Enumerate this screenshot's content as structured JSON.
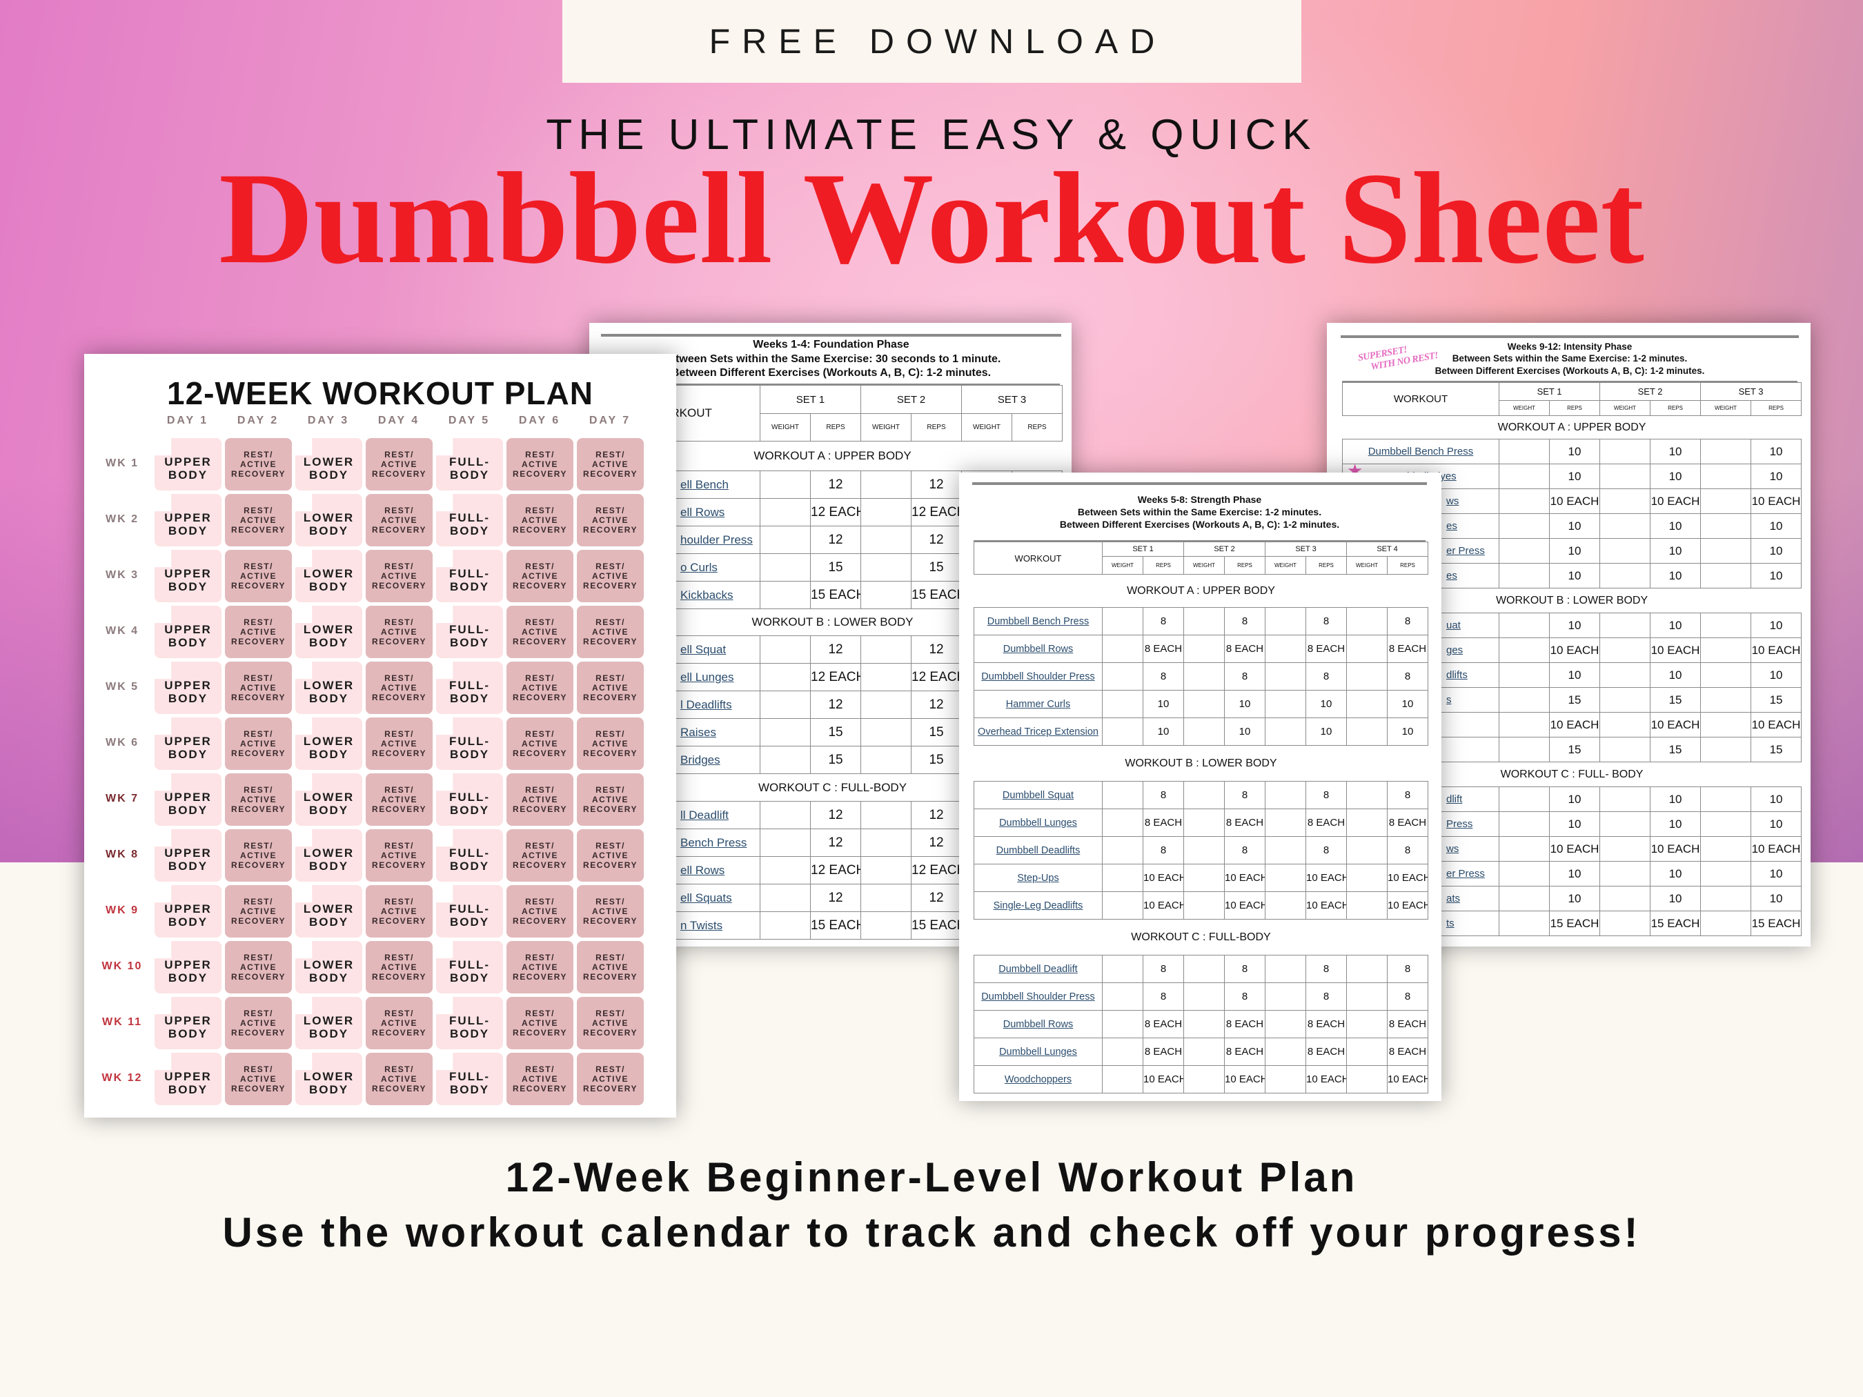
{
  "banner": {
    "free_download": "FREE DOWNLOAD",
    "subtitle": "THE ULTIMATE EASY & QUICK",
    "title": "Dumbbell Workout Sheet",
    "title_color": "#f01c24"
  },
  "plan": {
    "title": "12-WEEK WORKOUT PLAN",
    "days": [
      "DAY 1",
      "DAY 2",
      "DAY 3",
      "DAY 4",
      "DAY 5",
      "DAY 6",
      "DAY 7"
    ],
    "week_pattern": [
      {
        "type": "workout",
        "text": "UPPER\nBODY"
      },
      {
        "type": "rest",
        "text": "REST/\nACTIVE\nRECOVERY"
      },
      {
        "type": "workout",
        "text": "LOWER\nBODY"
      },
      {
        "type": "rest",
        "text": "REST/\nACTIVE\nRECOVERY"
      },
      {
        "type": "workout",
        "text": "FULL-\nBODY"
      },
      {
        "type": "rest",
        "text": "REST/\nACTIVE\nRECOVERY"
      },
      {
        "type": "rest",
        "text": "REST/\nACTIVE\nRECOVERY"
      }
    ],
    "weeks": [
      {
        "label": "WK 1",
        "color": "#8c7a7c"
      },
      {
        "label": "WK 2",
        "color": "#8c7a7c"
      },
      {
        "label": "WK 3",
        "color": "#8c7a7c"
      },
      {
        "label": "WK 4",
        "color": "#8c7a7c"
      },
      {
        "label": "WK 5",
        "color": "#8c7a7c"
      },
      {
        "label": "WK 6",
        "color": "#8c7a7c"
      },
      {
        "label": "WK 7",
        "color": "#7a2a2e"
      },
      {
        "label": "WK 8",
        "color": "#7a2a2e"
      },
      {
        "label": "WK 9",
        "color": "#c0343e"
      },
      {
        "label": "WK 10",
        "color": "#c0343e"
      },
      {
        "label": "WK 11",
        "color": "#c0343e"
      },
      {
        "label": "WK 12",
        "color": "#c0343e"
      }
    ],
    "colors": {
      "workout_cell": "#fde3e5",
      "rest_cell": "#e2b8bb"
    }
  },
  "sheets": [
    {
      "phase": "Weeks 1-4: Foundation Phase",
      "rest_sets": "Between Sets within the Same Exercise: 30 seconds to 1 minute.",
      "rest_exercises": "Between Different Exercises (Workouts A, B, C): 1-2 minutes.",
      "workout_header": "WORKOUT",
      "sets": [
        "SET 1",
        "SET 2",
        "SET 3"
      ],
      "weight_label": "WEIGHT",
      "reps_label": "REPS",
      "sections": [
        {
          "label": "WORKOUT A : UPPER BODY",
          "rows": [
            {
              "exercise": "ell Bench",
              "reps": "12"
            },
            {
              "exercise": "ell Rows",
              "reps": "12 EACH"
            },
            {
              "exercise": "houlder Press",
              "reps": "12"
            },
            {
              "exercise": "o Curls",
              "reps": "15"
            },
            {
              "exercise": "Kickbacks",
              "reps": "15 EACH"
            }
          ]
        },
        {
          "label": "WORKOUT B : LOWER BODY",
          "rows": [
            {
              "exercise": "ell Squat",
              "reps": "12"
            },
            {
              "exercise": "ell Lunges",
              "reps": "12 EACH"
            },
            {
              "exercise": "l Deadlifts",
              "reps": "12"
            },
            {
              "exercise": "Raises",
              "reps": "15"
            },
            {
              "exercise": "Bridges",
              "reps": "15"
            }
          ]
        },
        {
          "label": "WORKOUT C : FULL-BODY",
          "rows": [
            {
              "exercise": "ll Deadlift",
              "reps": "12"
            },
            {
              "exercise": "Bench Press",
              "reps": "12"
            },
            {
              "exercise": "ell Rows",
              "reps": "12 EACH"
            },
            {
              "exercise": "ell Squats",
              "reps": "12"
            },
            {
              "exercise": "n Twists",
              "reps": "15 EACH"
            }
          ]
        }
      ]
    },
    {
      "phase": "Weeks 5-8: Strength Phase",
      "rest_sets": "Between Sets within the Same Exercise:  1-2 minutes.",
      "rest_exercises": "Between Different Exercises (Workouts A, B, C): 1-2 minutes.",
      "workout_header": "WORKOUT",
      "sets": [
        "SET 1",
        "SET 2",
        "SET 3",
        "SET 4"
      ],
      "weight_label": "WEIGHT",
      "reps_label": "REPS",
      "sections": [
        {
          "label": "WORKOUT A : UPPER BODY",
          "rows": [
            {
              "exercise": "Dumbbell Bench Press",
              "reps": "8"
            },
            {
              "exercise": "Dumbbell Rows",
              "reps": "8 EACH"
            },
            {
              "exercise": "Dumbbell Shoulder Press",
              "reps": "8"
            },
            {
              "exercise": "Hammer Curls",
              "reps": "10"
            },
            {
              "exercise": "Overhead Tricep Extension",
              "reps": "10"
            }
          ]
        },
        {
          "label": "WORKOUT B : LOWER BODY",
          "rows": [
            {
              "exercise": "Dumbbell Squat",
              "reps": "8"
            },
            {
              "exercise": "Dumbbell Lunges",
              "reps": "8 EACH"
            },
            {
              "exercise": "Dumbbell Deadlifts",
              "reps": "8"
            },
            {
              "exercise": "Step-Ups",
              "reps": "10 EACH"
            },
            {
              "exercise": "Single-Leg Deadlifts",
              "reps": "10 EACH"
            }
          ]
        },
        {
          "label": "WORKOUT C : FULL-BODY",
          "rows": [
            {
              "exercise": "Dumbbell Deadlift",
              "reps": "8"
            },
            {
              "exercise": "Dumbbell Shoulder Press",
              "reps": "8"
            },
            {
              "exercise": "Dumbbell Rows",
              "reps": "8 EACH"
            },
            {
              "exercise": "Dumbbell Lunges",
              "reps": "8 EACH"
            },
            {
              "exercise": "Woodchoppers",
              "reps": "10 EACH"
            }
          ]
        }
      ]
    },
    {
      "phase": "Weeks 9-12: Intensity Phase",
      "rest_sets": "Between Sets within the Same Exercise: 1-2 minutes.",
      "rest_exercises": "Between Different Exercises (Workouts A, B, C): 1-2 minutes.",
      "workout_header": "WORKOUT",
      "sets": [
        "SET 1",
        "SET 2",
        "SET 3"
      ],
      "weight_label": "WEIGHT",
      "reps_label": "REPS",
      "stamp": {
        "line1": "SUPERSET!",
        "line2": "WITH NO REST!",
        "icon": "star-icon",
        "color": "#e46ac0"
      },
      "sections": [
        {
          "label": "WORKOUT A : UPPER BODY",
          "rows": [
            {
              "exercise": "Dumbbell Bench Press",
              "reps": "10"
            },
            {
              "exercise": "Dumbbell Flyes",
              "reps": "10",
              "superset": true
            },
            {
              "exercise": "ws",
              "reps": "10 EACH"
            },
            {
              "exercise": "es",
              "reps": "10"
            },
            {
              "exercise": "er Press",
              "reps": "10"
            },
            {
              "exercise": "es",
              "reps": "10"
            }
          ]
        },
        {
          "label": "WORKOUT B : LOWER BODY",
          "rows": [
            {
              "exercise": "uat",
              "reps": "10"
            },
            {
              "exercise": "ges",
              "reps": "10 EACH"
            },
            {
              "exercise": "dlifts",
              "reps": "10"
            },
            {
              "exercise": "s",
              "reps": "15"
            },
            {
              "exercise": "",
              "reps": "10 EACH"
            },
            {
              "exercise": "",
              "reps": "15"
            }
          ]
        },
        {
          "label": "WORKOUT C : FULL- BODY",
          "rows": [
            {
              "exercise": "dlift",
              "reps": "10"
            },
            {
              "exercise": "Press",
              "reps": "10"
            },
            {
              "exercise": "ws",
              "reps": "10 EACH"
            },
            {
              "exercise": "er Press",
              "reps": "10"
            },
            {
              "exercise": "ats",
              "reps": "10"
            },
            {
              "exercise": "ts",
              "reps": "15 EACH"
            }
          ]
        }
      ]
    }
  ],
  "footer": {
    "line1": "12-Week Beginner-Level Workout Plan",
    "line2": "Use the workout calendar to track and check off your progress!"
  }
}
